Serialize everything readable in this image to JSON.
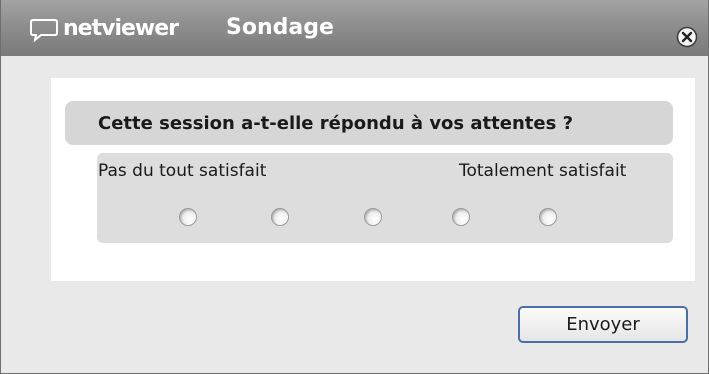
{
  "window": {
    "brand": "netviewer",
    "title": "Sondage",
    "close_icon": "close-circle-x-icon"
  },
  "survey": {
    "question": "Cette session a-t-elle répondu à vos attentes ?",
    "scale_min_label": "Pas du tout satisfait",
    "scale_max_label": "Totalement satisfait",
    "options_count": 5,
    "selected": null
  },
  "footer": {
    "send_label": "Envoyer"
  },
  "colors": {
    "titlebar": "#8e8e8e",
    "window_bg": "#e9e9e9",
    "question_bar": "#d6d6d6",
    "button_border": "#4a6fa8"
  }
}
